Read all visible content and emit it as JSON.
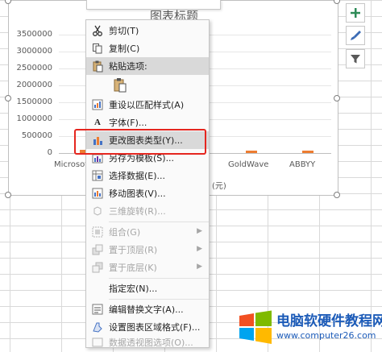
{
  "chart": {
    "title": "图表标题",
    "y_ticks": [
      "3500000",
      "3000000",
      "2500000",
      "2000000",
      "1500000",
      "1000000",
      "500000",
      "0"
    ],
    "x_labels": [
      "Microsoft",
      "GoldWave",
      "ABBYY"
    ],
    "x_axis_title_fragment": "(元)"
  },
  "chart_data": {
    "type": "bar",
    "categories": [
      "Microsoft",
      "GoldWave",
      "ABBYY"
    ],
    "series": [
      {
        "values": [
          100000,
          50000,
          50000
        ]
      }
    ],
    "title": "图表标题",
    "ylim": [
      0,
      3500000
    ]
  },
  "menu": {
    "items": [
      {
        "label": "剪切(T)",
        "icon": "scissors-icon",
        "disabled": false
      },
      {
        "label": "复制(C)",
        "icon": "copy-icon",
        "disabled": false
      },
      {
        "label": "粘贴选项:",
        "icon": "paste-icon",
        "disabled": false
      },
      {
        "label": "",
        "icon": "paste-option-icon",
        "disabled": false
      },
      {
        "label": "重设以匹配样式(A)",
        "icon": "reset-style-icon",
        "disabled": false
      },
      {
        "label": "字体(F)...",
        "icon": "font-icon",
        "disabled": false
      },
      {
        "label": "更改图表类型(Y)...",
        "icon": "chart-type-icon",
        "disabled": false
      },
      {
        "label": "另存为模板(S)...",
        "icon": "save-template-icon",
        "disabled": false
      },
      {
        "label": "选择数据(E)...",
        "icon": "select-data-icon",
        "disabled": false
      },
      {
        "label": "移动图表(V)...",
        "icon": "move-chart-icon",
        "disabled": false
      },
      {
        "label": "三维旋转(R)...",
        "icon": "rotate-3d-icon",
        "disabled": true
      },
      {
        "label": "组合(G)",
        "icon": "group-icon",
        "disabled": true
      },
      {
        "label": "置于顶层(R)",
        "icon": "bring-front-icon",
        "disabled": true
      },
      {
        "label": "置于底层(K)",
        "icon": "send-back-icon",
        "disabled": true
      },
      {
        "label": "指定宏(N)...",
        "icon": "macro-icon",
        "disabled": false
      },
      {
        "label": "编辑替换文字(A)...",
        "icon": "alt-text-icon",
        "disabled": false
      },
      {
        "label": "设置图表区域格式(F)...",
        "icon": "format-chart-icon",
        "disabled": false
      },
      {
        "label": "数据透视图选项(O)...",
        "icon": "pivot-options-icon",
        "disabled": true
      }
    ]
  },
  "watermark": {
    "title": "电脑软硬件教程网",
    "url": "www.computer26.com"
  },
  "colors": {
    "bar": "#ed7d31",
    "highlight_box": "#e5261f",
    "menu_highlight": "#d9d9d9",
    "watermark": "#1c5bb8"
  }
}
